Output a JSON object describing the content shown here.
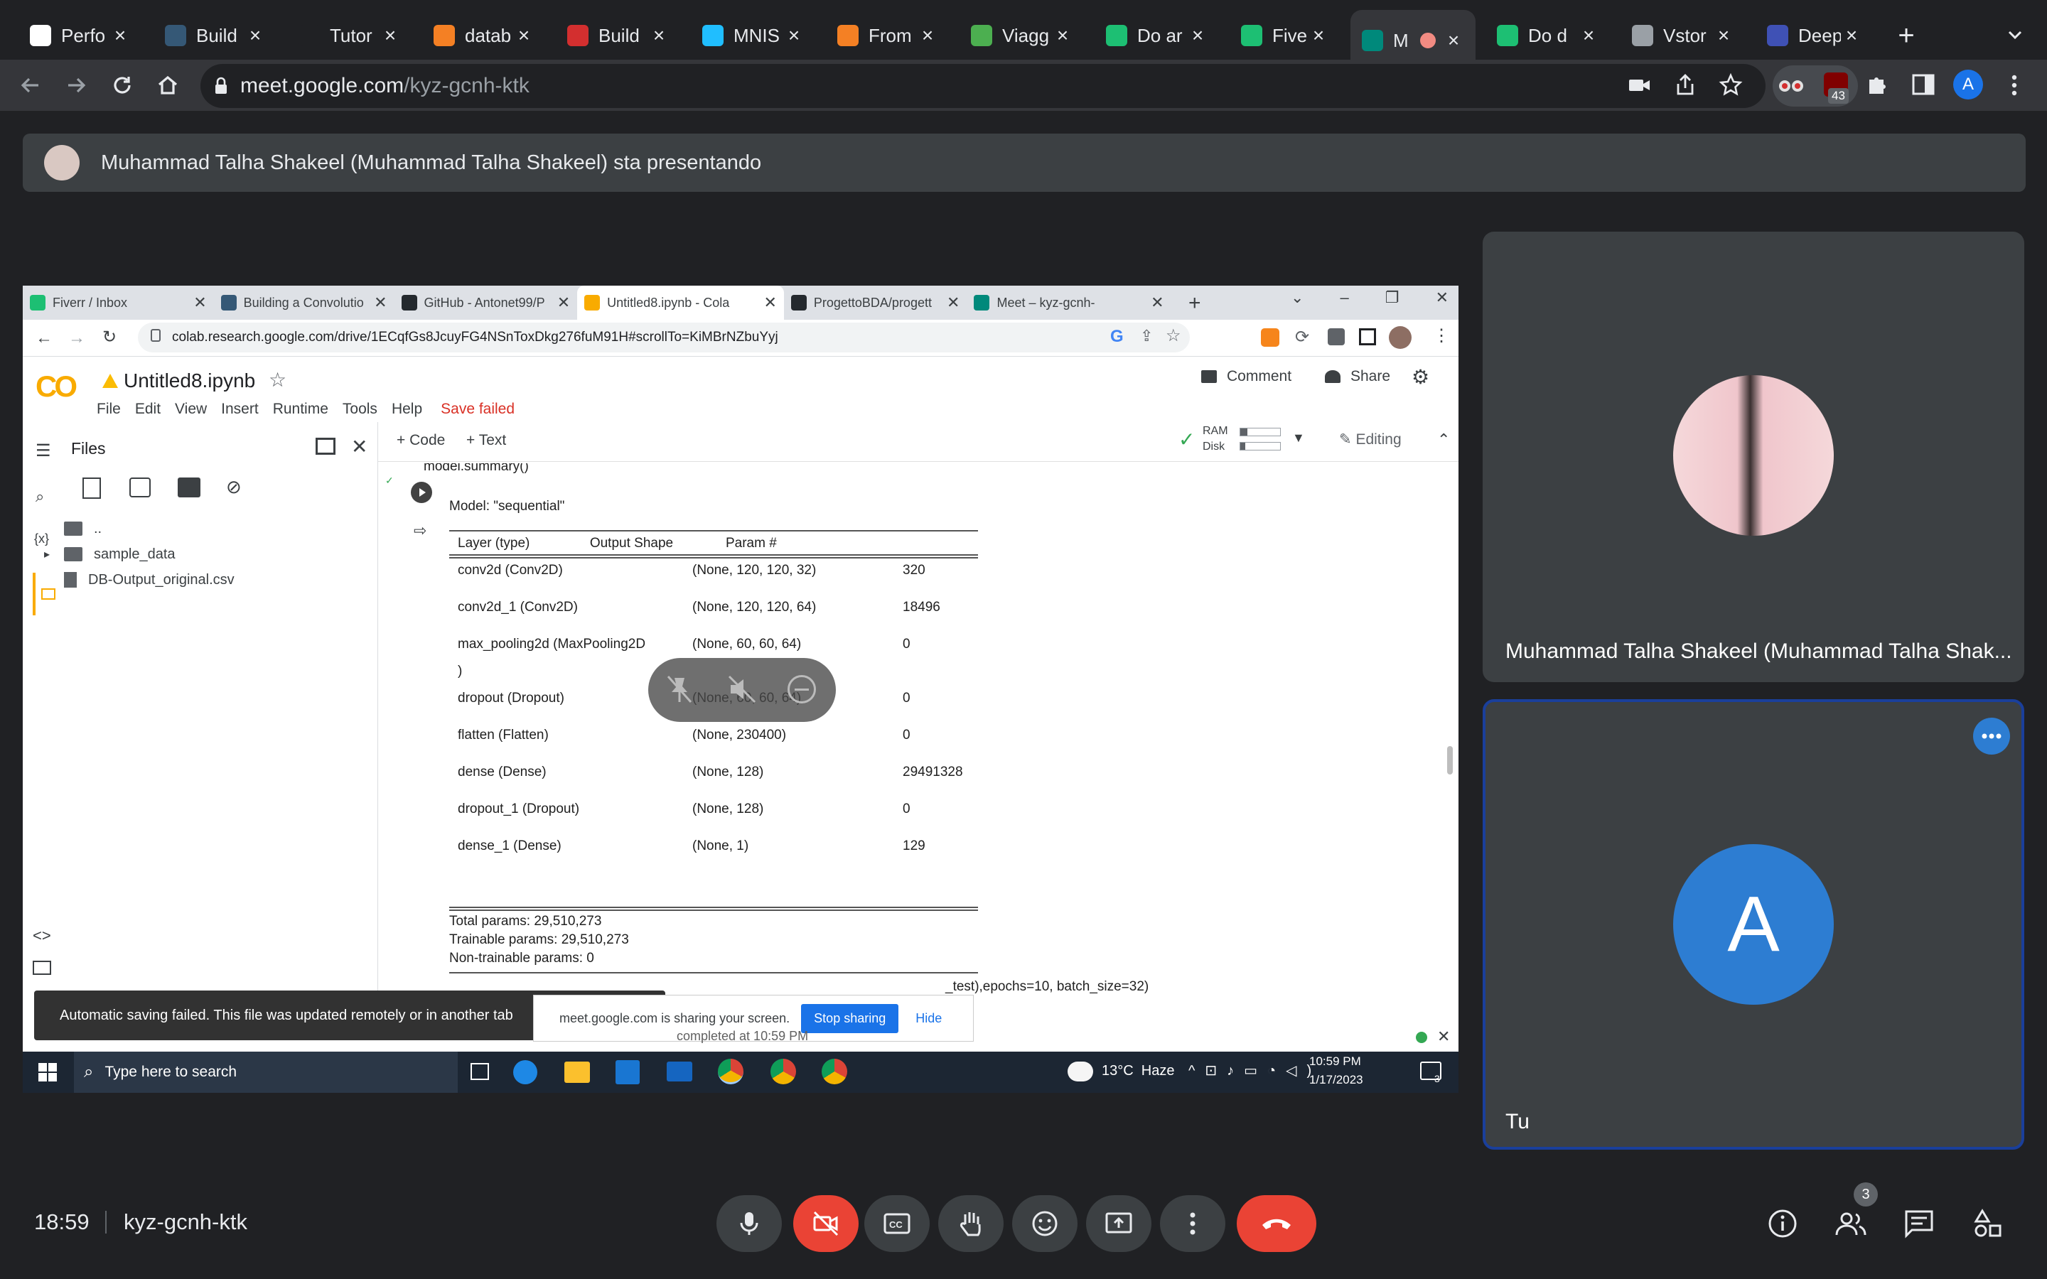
{
  "browser": {
    "tabs": [
      {
        "title": "Perfo",
        "icon": "chart-logo-icon",
        "color": "#ffffff"
      },
      {
        "title": "Build",
        "icon": "tds-logo-icon",
        "color": "#355876"
      },
      {
        "title": "Tutor",
        "icon": "medium-logo-icon",
        "color": "#202124"
      },
      {
        "title": "datab",
        "icon": "stackoverflow-icon",
        "color": "#f48024"
      },
      {
        "title": "Build",
        "icon": "k-logo-icon",
        "color": "#d32f2f"
      },
      {
        "title": "MNIS",
        "icon": "kaggle-logo-icon",
        "color": "#20beff"
      },
      {
        "title": "From",
        "icon": "stackoverflow-icon",
        "color": "#f48024"
      },
      {
        "title": "Viagg",
        "icon": "victory-hand-icon",
        "color": "#4caf50"
      },
      {
        "title": "Do ar",
        "icon": "fiverr-logo-icon",
        "color": "#1dbf73"
      },
      {
        "title": "Fiver",
        "icon": "fiverr-logo-icon",
        "color": "#1dbf73"
      },
      {
        "title": "M",
        "icon": "meet-logo-icon",
        "color": "#00897b"
      },
      {
        "title": "Do d",
        "icon": "fiverr-logo-icon",
        "color": "#1dbf73"
      },
      {
        "title": "Vstor",
        "icon": "globe-icon",
        "color": "#9aa0a6"
      },
      {
        "title": "Deep",
        "icon": "shield-logo-icon",
        "color": "#3f51b5"
      }
    ],
    "url_host": "meet.google.com",
    "url_path": "/kyz-gcnh-ktk",
    "extension_badge": "43",
    "profile_initial": "A"
  },
  "banner": {
    "text": "Muhammad Talha Shakeel (Muhammad Talha Shakeel) sta presentando"
  },
  "shared_screen": {
    "tabs": [
      {
        "title": "Fiverr / Inbox",
        "color": "#1dbf73"
      },
      {
        "title": "Building a Convolutio",
        "color": "#355876"
      },
      {
        "title": "GitHub - Antonet99/P",
        "color": "#24292e"
      },
      {
        "title": "Untitled8.ipynb - Cola",
        "color": "#f9ab00"
      },
      {
        "title": "ProgettoBDA/progett",
        "color": "#24292e"
      },
      {
        "title": "Meet – kyz-gcnh-",
        "color": "#00897b"
      }
    ],
    "url": "colab.research.google.com/drive/1ECqfGs8JcuyFG4NSnToxDkg276fuM91H#scrollTo=KiMBrNZbuYyj",
    "notebook_name": "Untitled8.ipynb",
    "menus": [
      "File",
      "Edit",
      "View",
      "Insert",
      "Runtime",
      "Tools",
      "Help"
    ],
    "save_status": "Save failed",
    "comment_label": "Comment",
    "share_label": "Share",
    "add_code": "+ Code",
    "add_text": "+ Text",
    "ram_label": "RAM",
    "disk_label": "Disk",
    "editing_label": "Editing",
    "files_title": "Files",
    "files": [
      {
        "name": "..",
        "kind": "parent"
      },
      {
        "name": "sample_data",
        "kind": "folder"
      },
      {
        "name": "DB-Output_original.csv",
        "kind": "file"
      }
    ],
    "code_top": "model.summary()",
    "summary": {
      "model_line": "Model: \"sequential\"",
      "header": "Layer (type)                Output Shape              Param #",
      "rows": [
        [
          "conv2d (Conv2D)",
          "(None, 120, 120, 32)",
          "320"
        ],
        [
          "conv2d_1 (Conv2D)",
          "(None, 120, 120, 64)",
          "18496"
        ],
        [
          "max_pooling2d (MaxPooling2D",
          "(None, 60, 60, 64)",
          "0"
        ],
        [
          "dropout (Dropout)",
          "(None, 60, 60, 64)",
          "0"
        ],
        [
          "flatten (Flatten)",
          "(None, 230400)",
          "0"
        ],
        [
          "dense (Dense)",
          "(None, 128)",
          "29491328"
        ],
        [
          "dropout_1 (Dropout)",
          "(None, 128)",
          "0"
        ],
        [
          "dense_1 (Dense)",
          "(None, 1)",
          "129"
        ]
      ],
      "wrap_char": ")",
      "total": "Total params: 29,510,273",
      "trainable": "Trainable params: 29,510,273",
      "non_trainable": "Non-trainable params: 0"
    },
    "next_code": "_test),epochs=10, batch_size=32)",
    "toast": "Automatic saving failed. This file was updated remotely or in another tab",
    "share_notice": "meet.google.com is sharing your screen.",
    "stop_sharing": "Stop sharing",
    "hide": "Hide",
    "status_line": "completed at 10:59 PM",
    "taskbar": {
      "search_placeholder": "Type here to search",
      "weather": "13°C  Haze",
      "time": "10:59 PM",
      "date": "1/17/2023",
      "notif_count": "3"
    }
  },
  "participants": [
    {
      "name": "Muhammad Talha Shakeel (Muhammad Talha Shak..."
    },
    {
      "name": "Tu",
      "initial": "A",
      "avatar_color": "#2d7dd2"
    }
  ],
  "bottom": {
    "time": "18:59",
    "meeting_code": "kyz-gcnh-ktk",
    "people_count": "3"
  }
}
